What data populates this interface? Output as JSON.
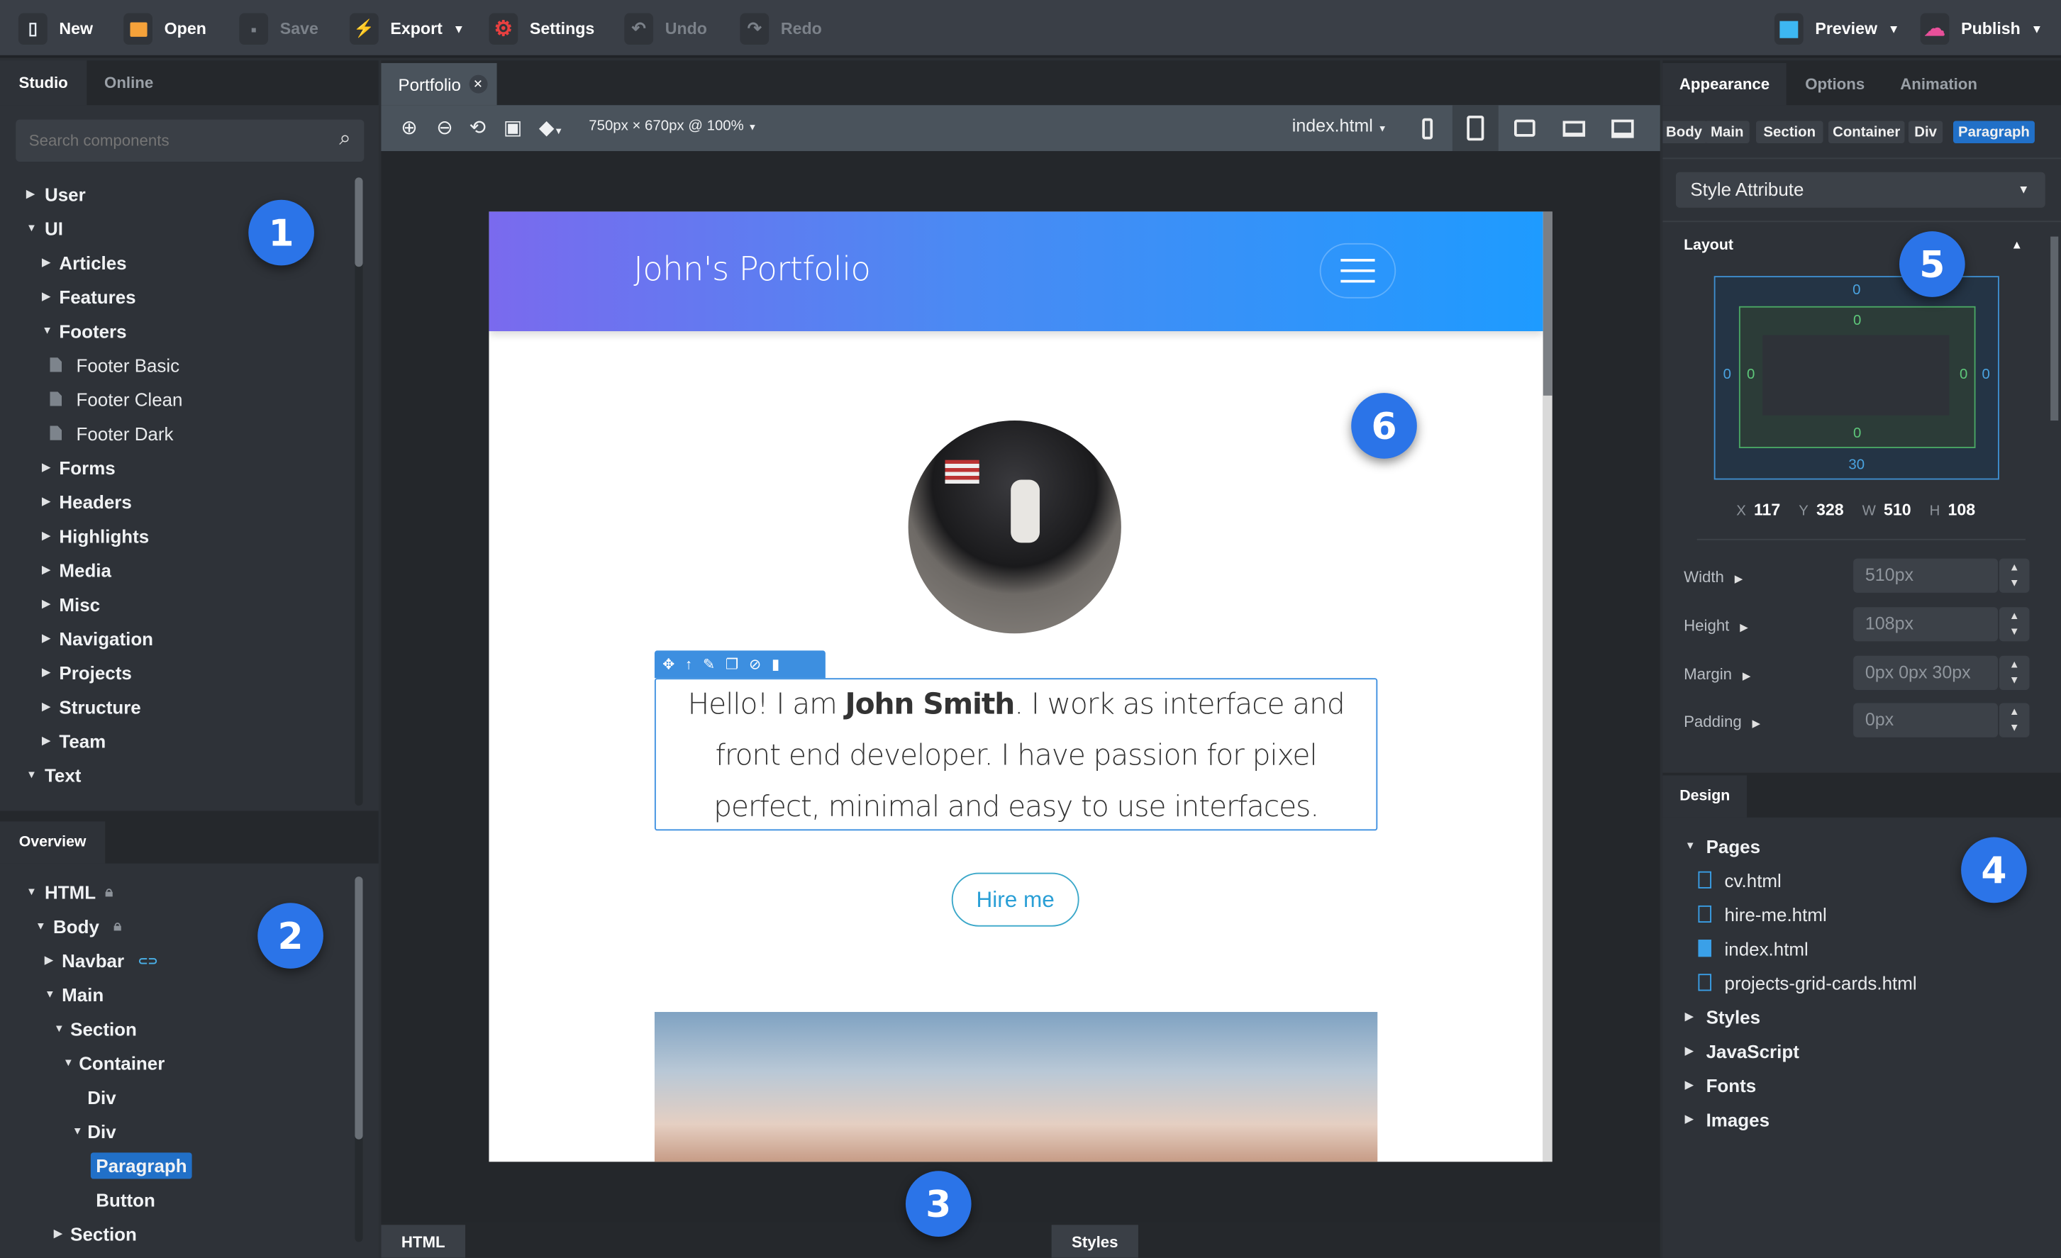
{
  "toolbar": {
    "new": "New",
    "open": "Open",
    "save": "Save",
    "export": "Export",
    "settings": "Settings",
    "undo": "Undo",
    "redo": "Redo",
    "preview": "Preview",
    "publish": "Publish",
    "icon_colors": {
      "new": "#e8eef5",
      "open": "#f5a23a",
      "export": "#4bd548",
      "settings": "#e84040",
      "preview": "#3db7f2",
      "publish": "#e8509a"
    }
  },
  "left": {
    "tabs": [
      "Studio",
      "Online"
    ],
    "search_placeholder": "Search components",
    "components": [
      {
        "label": "User",
        "level": 0,
        "type": "closed"
      },
      {
        "label": "UI",
        "level": 0,
        "type": "open"
      },
      {
        "label": "Articles",
        "level": 1,
        "type": "closed"
      },
      {
        "label": "Features",
        "level": 1,
        "type": "closed"
      },
      {
        "label": "Footers",
        "level": 1,
        "type": "open"
      },
      {
        "label": "Footer Basic",
        "level": 2,
        "type": "file"
      },
      {
        "label": "Footer Clean",
        "level": 2,
        "type": "file"
      },
      {
        "label": "Footer Dark",
        "level": 2,
        "type": "file"
      },
      {
        "label": "Forms",
        "level": 1,
        "type": "closed"
      },
      {
        "label": "Headers",
        "level": 1,
        "type": "closed"
      },
      {
        "label": "Highlights",
        "level": 1,
        "type": "closed"
      },
      {
        "label": "Media",
        "level": 1,
        "type": "closed"
      },
      {
        "label": "Misc",
        "level": 1,
        "type": "closed"
      },
      {
        "label": "Navigation",
        "level": 1,
        "type": "closed"
      },
      {
        "label": "Projects",
        "level": 1,
        "type": "closed"
      },
      {
        "label": "Structure",
        "level": 1,
        "type": "closed"
      },
      {
        "label": "Team",
        "level": 1,
        "type": "closed"
      },
      {
        "label": "Text",
        "level": 0,
        "type": "open"
      }
    ],
    "overview_tab": "Overview",
    "overview": [
      {
        "label": "HTML",
        "level": 0,
        "type": "open",
        "badge": "lock"
      },
      {
        "label": "Body",
        "level": 1,
        "type": "open",
        "badge": "lock"
      },
      {
        "label": "Navbar",
        "level": 2,
        "type": "closed",
        "badge": "link"
      },
      {
        "label": "Main",
        "level": 2,
        "type": "open"
      },
      {
        "label": "Section",
        "level": 3,
        "type": "open"
      },
      {
        "label": "Container",
        "level": 4,
        "type": "open"
      },
      {
        "label": "Div",
        "level": 5,
        "type": "leaf"
      },
      {
        "label": "Div",
        "level": 5,
        "type": "open"
      },
      {
        "label": "Paragraph",
        "level": 6,
        "type": "leaf",
        "selected": true
      },
      {
        "label": "Button",
        "level": 6,
        "type": "leaf"
      },
      {
        "label": "Section",
        "level": 3,
        "type": "closed"
      }
    ]
  },
  "center": {
    "doc_tab": "Portfolio",
    "size_label": "750px × 670px @ 100%",
    "page_select": "index.html",
    "bottom_tabs": [
      "HTML",
      "Styles"
    ],
    "site": {
      "brand": "John's Portfolio",
      "intro_pre": "Hello! I am ",
      "intro_name": "John Smith",
      "intro_post": ". I work as interface and front end developer. I have passion for pixel perfect, minimal and easy to use interfaces.",
      "button": "Hire me"
    }
  },
  "right": {
    "tabs": [
      "Appearance",
      "Options",
      "Animation"
    ],
    "breadcrumb": [
      "Body",
      "Main",
      "Section",
      "Container",
      "Div",
      "Paragraph"
    ],
    "style_select": "Style Attribute",
    "layout_title": "Layout",
    "box": {
      "margin": {
        "top": "0",
        "right": "0",
        "bottom": "30",
        "left": "0"
      },
      "padding": {
        "top": "0",
        "right": "0",
        "bottom": "0",
        "left": "0"
      }
    },
    "geometry": {
      "x_label": "X",
      "x": "117",
      "y_label": "Y",
      "y": "328",
      "w_label": "W",
      "w": "510",
      "h_label": "H",
      "h": "108"
    },
    "props": [
      {
        "label": "Width",
        "value": "510px"
      },
      {
        "label": "Height",
        "value": "108px"
      },
      {
        "label": "Margin",
        "value": "0px 0px 30px"
      },
      {
        "label": "Padding",
        "value": "0px"
      }
    ],
    "design_tab": "Design",
    "design": [
      {
        "label": "Pages",
        "type": "open"
      },
      {
        "label": "cv.html",
        "type": "file"
      },
      {
        "label": "hire-me.html",
        "type": "file"
      },
      {
        "label": "index.html",
        "type": "file",
        "active": true
      },
      {
        "label": "projects-grid-cards.html",
        "type": "file"
      },
      {
        "label": "Styles",
        "type": "closed"
      },
      {
        "label": "JavaScript",
        "type": "closed"
      },
      {
        "label": "Fonts",
        "type": "closed"
      },
      {
        "label": "Images",
        "type": "closed"
      }
    ]
  },
  "callouts": [
    "1",
    "2",
    "3",
    "4",
    "5",
    "6"
  ],
  "accent": "#2b74e8"
}
